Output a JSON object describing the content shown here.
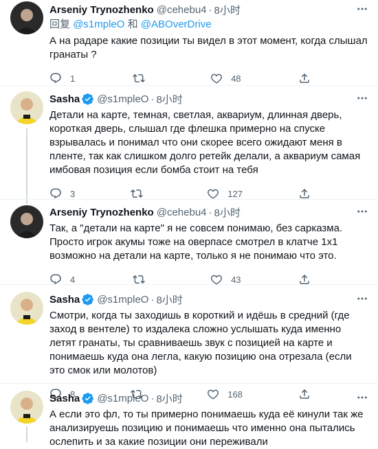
{
  "tweets": [
    {
      "name": "Arseniy Trynozhenko",
      "handle": "@cehebu4",
      "sep": "·",
      "time": "8小时",
      "verified": false,
      "reply_prefix": "回复",
      "reply_mention1": "@s1mpleO",
      "reply_and": "和",
      "reply_mention2": "@ABOverDrive",
      "text": "А на радаре какие позиции ты видел в этот момент, когда слышал гранаты ?",
      "reply_count": "1",
      "retweet_count": "",
      "like_count": "48"
    },
    {
      "name": "Sasha",
      "handle": "@s1mpleO",
      "sep": "·",
      "time": "8小时",
      "verified": true,
      "text": "Детали на карте, темная, светлая, аквариум, длинная дверь, короткая дверь, слышал где флешка примерно на спуске взрывалась и понимал что они скорее всего ожидают меня в пленте, так как слишком долго ретейк делали, а аквариум самая имбовая позиция если бомба стоит на тебя",
      "reply_count": "3",
      "retweet_count": "",
      "like_count": "127"
    },
    {
      "name": "Arseniy Trynozhenko",
      "handle": "@cehebu4",
      "sep": "·",
      "time": "8小时",
      "verified": false,
      "text": "Так, а \"детали на карте\" я не совсем понимаю, без сарказма. Просто игрок акумы тоже на оверпасе смотрел в клатче 1x1 возможно на детали на карте, только я не понимаю что это.",
      "reply_count": "4",
      "retweet_count": "",
      "like_count": "43"
    },
    {
      "name": "Sasha",
      "handle": "@s1mpleO",
      "sep": "·",
      "time": "8小时",
      "verified": true,
      "text": "Смотри, когда ты заходишь в короткий и идёшь в средний (где заход в вентеле) то издалека сложно услышать куда именно летят гранаты, ты сравниваешь звук с позицией на карте и понимаешь куда она легла, какую позицию она отрезала (если это смок или молотов)",
      "reply_count": "8",
      "retweet_count": "",
      "like_count": "168"
    },
    {
      "name": "Sasha",
      "handle": "@s1mpleO",
      "sep": "·",
      "time": "8小时",
      "verified": true,
      "text": "А если это фл, то ты примерно понимаешь куда её кинули так же анализируешь позицию и понимаешь что именно она пытались ослепить и за какие позиции они переживали"
    }
  ],
  "colors": {
    "accent": "#1d9bf0",
    "muted": "#536471",
    "text": "#0f1419"
  },
  "icons": [
    "more-icon",
    "reply-icon",
    "retweet-icon",
    "like-icon",
    "share-icon",
    "verified-badge-icon"
  ]
}
